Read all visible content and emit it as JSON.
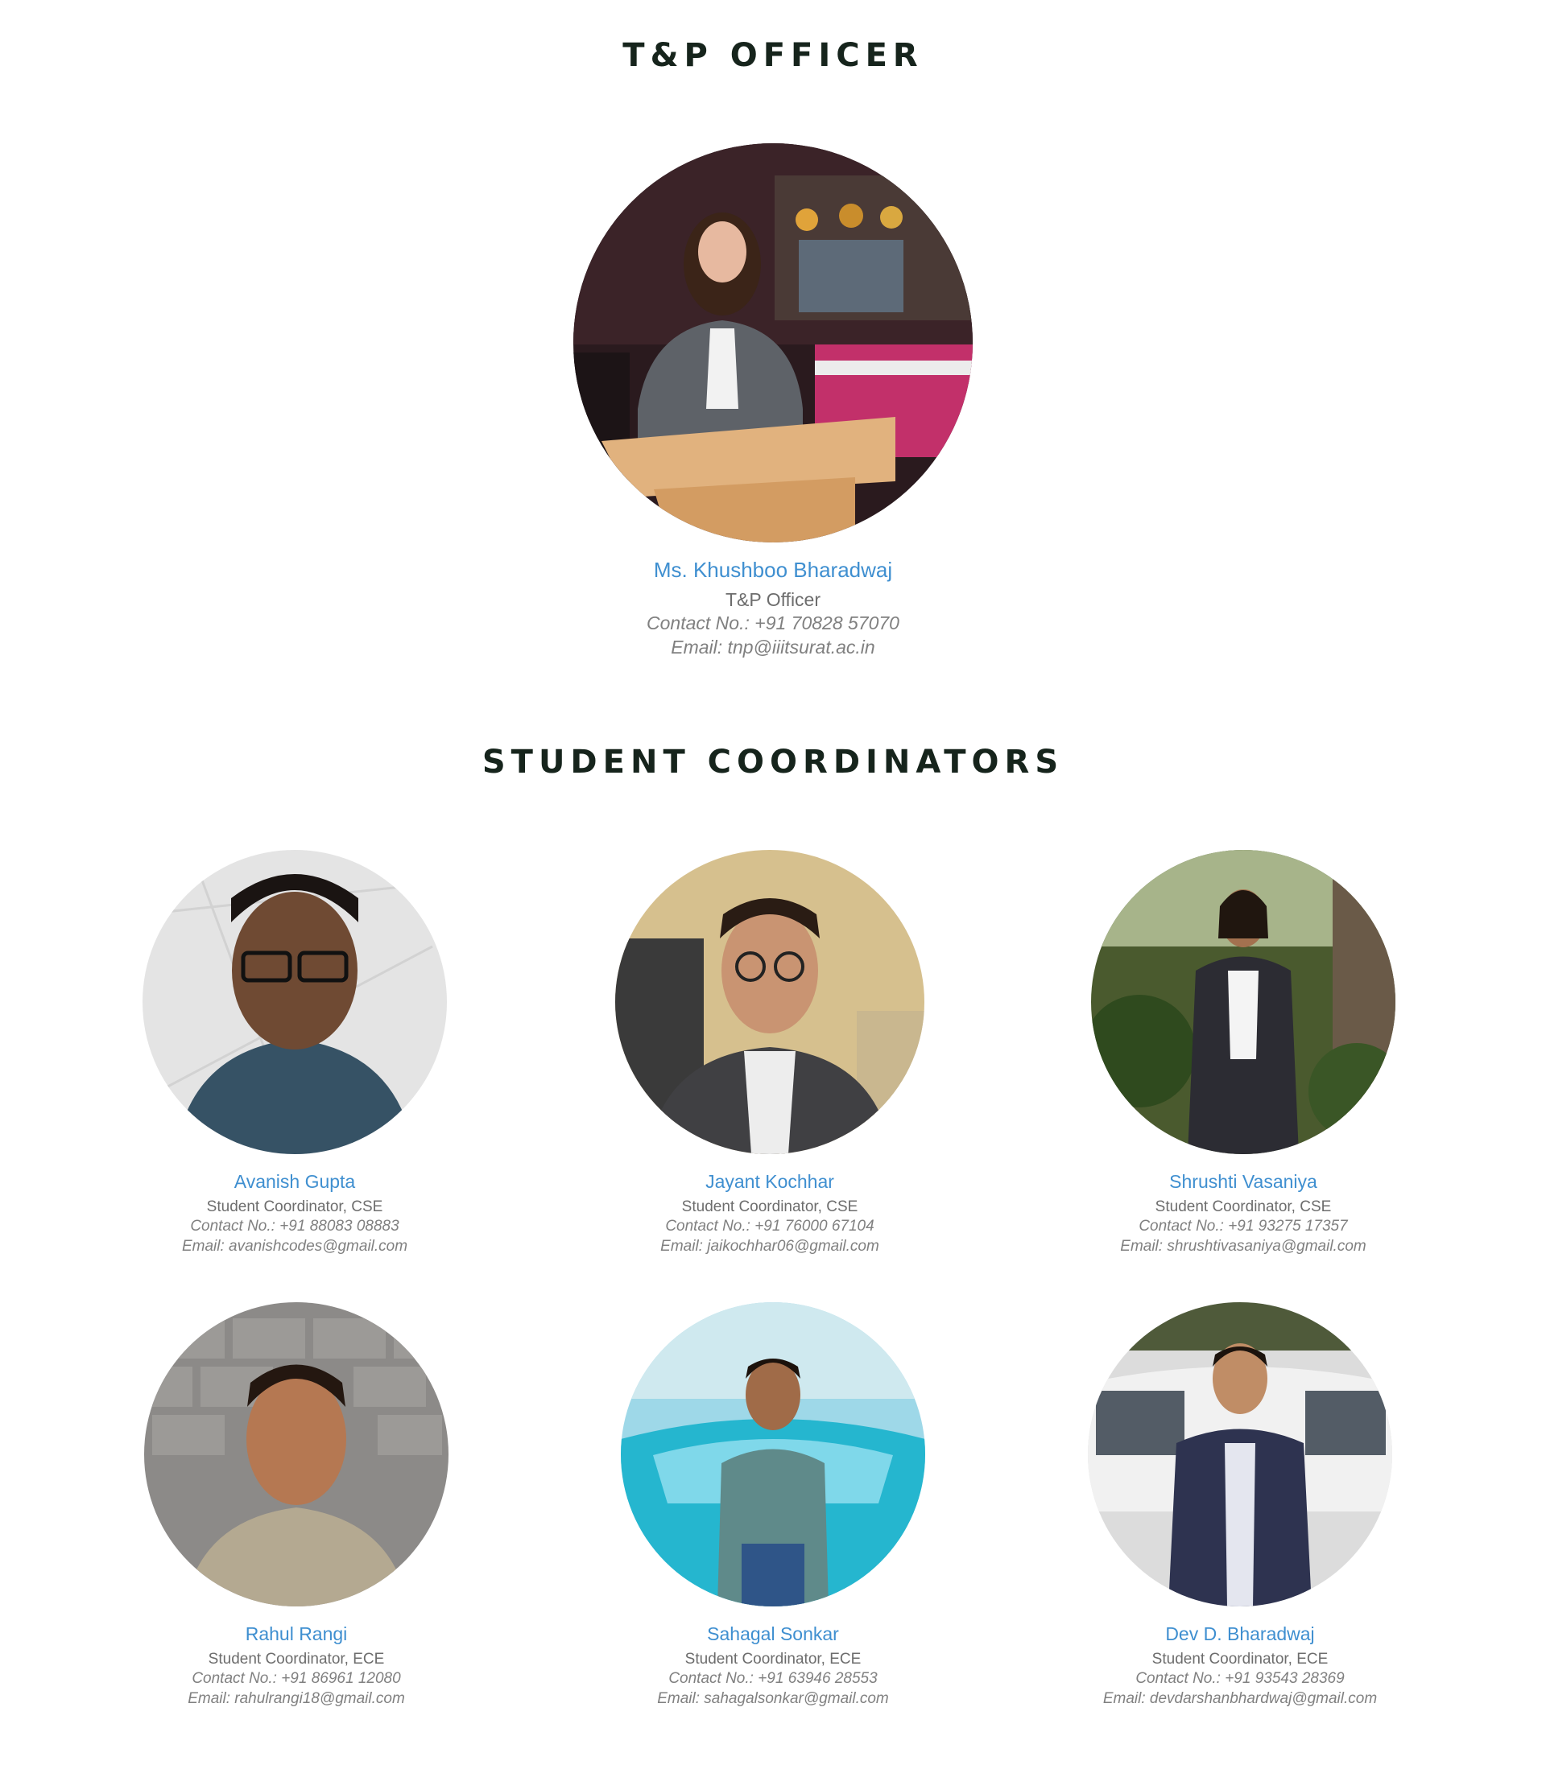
{
  "officer_section": {
    "title": "T&P OFFICER",
    "person": {
      "name": "Ms. Khushboo Bharadwaj",
      "role": "T&P Officer",
      "contact": "Contact No.: +91 70828 57070",
      "email": "Email: tnp@iiitsurat.ac.in",
      "photo": "khushboo-bharadwaj-photo"
    }
  },
  "coordinators_section": {
    "title": "STUDENT COORDINATORS",
    "people": [
      {
        "name": "Avanish Gupta",
        "role": "Student Coordinator, CSE",
        "contact": "Contact No.: +91 88083 08883",
        "email": "Email: avanishcodes@gmail.com",
        "photo": "avanish-gupta-photo"
      },
      {
        "name": "Jayant Kochhar",
        "role": "Student Coordinator, CSE",
        "contact": "Contact No.: +91 76000 67104",
        "email": "Email: jaikochhar06@gmail.com",
        "photo": "jayant-kochhar-photo"
      },
      {
        "name": "Shrushti Vasaniya",
        "role": "Student Coordinator, CSE",
        "contact": "Contact No.: +91 93275 17357",
        "email": "Email: shrushtivasaniya@gmail.com",
        "photo": "shrushti-vasaniya-photo"
      },
      {
        "name": "Rahul Rangi",
        "role": "Student Coordinator, ECE",
        "contact": "Contact No.: +91 86961 12080",
        "email": "Email: rahulrangi18@gmail.com",
        "photo": "rahul-rangi-photo"
      },
      {
        "name": "Sahagal Sonkar",
        "role": "Student Coordinator, ECE",
        "contact": "Contact No.: +91 63946 28553",
        "email": "Email: sahagalsonkar@gmail.com",
        "photo": "sahagal-sonkar-photo"
      },
      {
        "name": "Dev D. Bharadwaj",
        "role": "Student Coordinator, ECE",
        "contact": "Contact No.: +91 93543 28369",
        "email": "Email: devdarshanbhardwaj@gmail.com",
        "photo": "dev-bharadwaj-photo"
      }
    ]
  },
  "colors": {
    "heading": "#16241c",
    "name": "#3f8fd0",
    "role": "#6d6d6d",
    "detail": "#808080",
    "background": "#ffffff"
  }
}
